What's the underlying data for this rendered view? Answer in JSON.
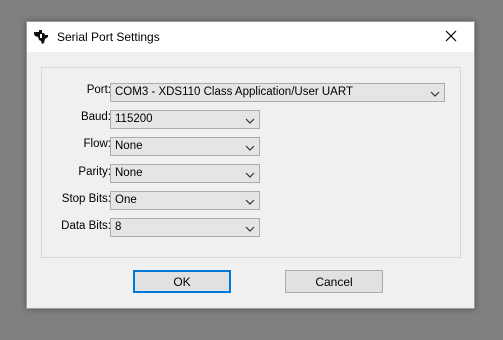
{
  "window": {
    "title": "Serial Port Settings",
    "close_glyph": "✕",
    "icon": "ti-logo-icon"
  },
  "fields": {
    "port": {
      "label": "Port:",
      "value": "COM3 - XDS110 Class Application/User UART"
    },
    "baud": {
      "label": "Baud:",
      "value": "115200"
    },
    "flow": {
      "label": "Flow:",
      "value": "None"
    },
    "parity": {
      "label": "Parity:",
      "value": "None"
    },
    "stop_bits": {
      "label": "Stop Bits:",
      "value": "One"
    },
    "data_bits": {
      "label": "Data Bits:",
      "value": "8"
    }
  },
  "buttons": {
    "ok": "OK",
    "cancel": "Cancel"
  },
  "colors": {
    "accent": "#0078d7",
    "titlebar": "#ffffff",
    "dialog_bg": "#f0f0f0",
    "desktop": "#808080"
  }
}
